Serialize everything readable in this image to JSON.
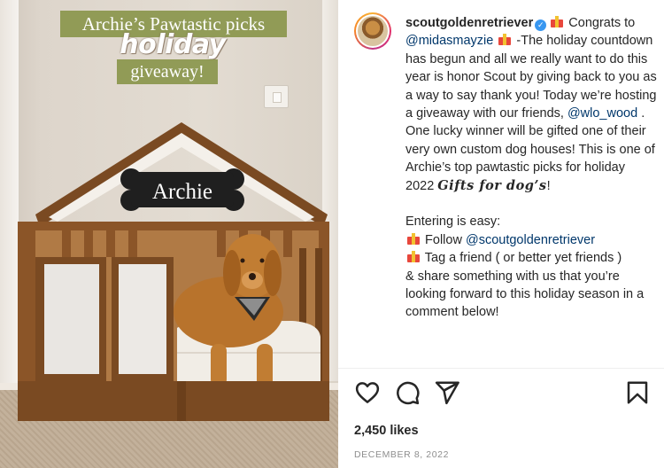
{
  "media": {
    "overlay_line1": "Archie’s Pawtastic picks",
    "overlay_line2": "holiday",
    "overlay_line3": "giveaway!",
    "sign_name": "Archie"
  },
  "post": {
    "username": "scoutgoldenretriever",
    "verified_icon": "verified-badge-icon",
    "caption_p1_a": " Congrats to ",
    "mention_1": "@midasmayzie",
    "caption_p1_b": " -The holiday countdown has begun and all we really want to do this year is honor Scout by giving back to you as a way to say thank you! Today we’re hosting a giveaway with our friends, ",
    "mention_2": "@wlo_wood",
    "caption_p1_c": " . One lucky winner will be gifted one of their very own custom dog houses! This is one of Archie’s top pawtastic picks for holiday 2022 ",
    "caption_script": "Gifts for dog’s",
    "caption_p1_d": "!",
    "entering_heading": "Entering is easy:",
    "step1_a": " Follow ",
    "mention_3": "@scoutgoldenretriever",
    "step2": " Tag a friend ( or better yet friends )",
    "step3": "& share something with us that you’re looking forward to this holiday season in a comment below!",
    "likes": "2,450 likes",
    "date": "DECEMBER 8, 2022"
  },
  "icons": {
    "like": "heart-icon",
    "comment": "comment-icon",
    "share": "send-icon",
    "save": "bookmark-icon",
    "gift": "gift-emoji-icon"
  },
  "colors": {
    "mention": "#00376b",
    "overlay_bg": "#8a964c",
    "verified": "#3897f0"
  }
}
